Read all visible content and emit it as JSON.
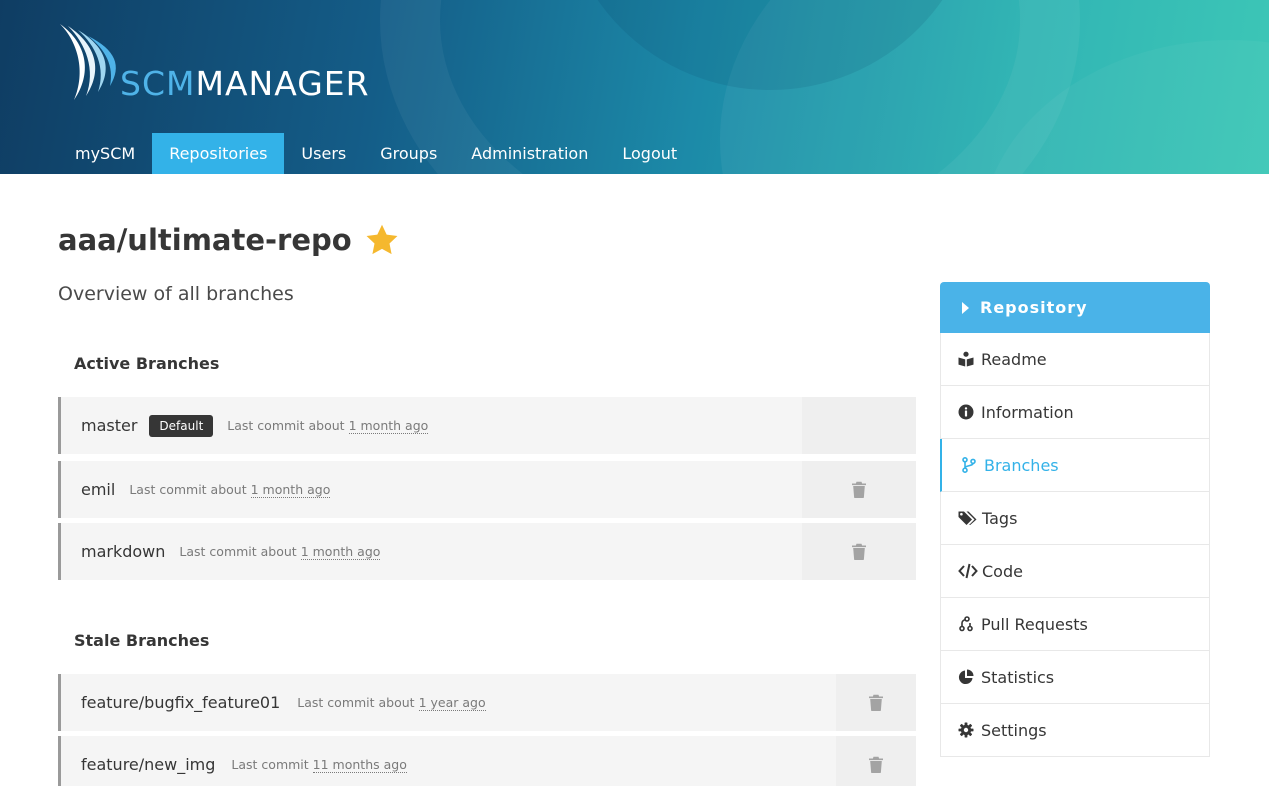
{
  "header": {
    "logo": {
      "prefix": "SCM",
      "suffix": "MANAGER"
    },
    "nav": [
      {
        "label": "mySCM",
        "active": false
      },
      {
        "label": "Repositories",
        "active": true
      },
      {
        "label": "Users",
        "active": false
      },
      {
        "label": "Groups",
        "active": false
      },
      {
        "label": "Administration",
        "active": false
      },
      {
        "label": "Logout",
        "active": false
      }
    ]
  },
  "page": {
    "title": "aaa/ultimate-repo",
    "favorite_icon": "star-icon",
    "subtitle": "Overview of all branches"
  },
  "active_branches": {
    "title": "Active Branches",
    "rows": [
      {
        "name": "master",
        "badge": "Default",
        "commit_prefix": "Last commit about",
        "commit_time": "1 month ago",
        "deletable": false
      },
      {
        "name": "emil",
        "badge": "",
        "commit_prefix": "Last commit about",
        "commit_time": "1 month ago",
        "deletable": true
      },
      {
        "name": "markdown",
        "badge": "",
        "commit_prefix": "Last commit about",
        "commit_time": "1 month ago",
        "deletable": true
      }
    ]
  },
  "stale_branches": {
    "title": "Stale Branches",
    "rows": [
      {
        "name": "feature/bugfix_feature01",
        "commit_prefix": "Last commit about",
        "commit_time": "1 year ago",
        "deletable": true
      },
      {
        "name": "feature/new_img",
        "commit_prefix": "Last commit",
        "commit_time": "11 months ago",
        "deletable": true
      }
    ]
  },
  "sidebar": {
    "header": "Repository",
    "items": [
      {
        "label": "Readme",
        "icon": "book-reader-icon",
        "active": false
      },
      {
        "label": "Information",
        "icon": "info-circle-icon",
        "active": false
      },
      {
        "label": "Branches",
        "icon": "code-branch-icon",
        "active": true
      },
      {
        "label": "Tags",
        "icon": "tags-icon",
        "active": false
      },
      {
        "label": "Code",
        "icon": "code-icon",
        "active": false
      },
      {
        "label": "Pull Requests",
        "icon": "pull-request-icon",
        "active": false
      },
      {
        "label": "Statistics",
        "icon": "chart-pie-icon",
        "active": false
      },
      {
        "label": "Settings",
        "icon": "cog-icon",
        "active": false
      }
    ]
  },
  "colors": {
    "accent": "#33b2e8",
    "star": "#f5b82e",
    "badge_bg": "#363636"
  }
}
